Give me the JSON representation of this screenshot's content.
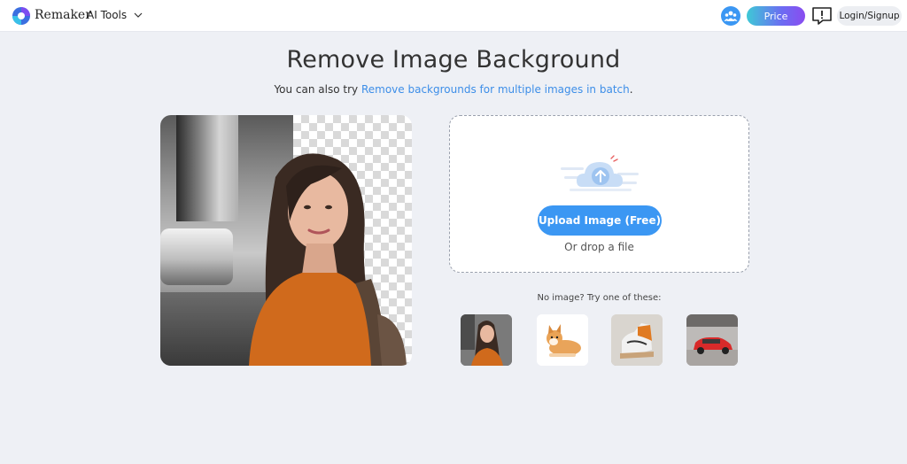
{
  "header": {
    "brand": "Remaker",
    "ai_tools_label": "AI Tools",
    "price_label": "Price",
    "login_label": "Login/Signup"
  },
  "main": {
    "title": "Remove Image Background",
    "subtitle_prefix": "You can also try ",
    "subtitle_link": "Remove backgrounds for multiple images in batch",
    "subtitle_suffix": "."
  },
  "upload": {
    "button_label": "Upload Image (Free)",
    "drop_text": "Or drop a file"
  },
  "samples": {
    "prompt": "No image? Try one of these:",
    "items": [
      "woman-thumbnail",
      "dog-thumbnail",
      "sneaker-thumbnail",
      "car-thumbnail"
    ]
  },
  "colors": {
    "accent": "#3b97f3",
    "link": "#3d8ee8",
    "background": "#eef0f5"
  }
}
